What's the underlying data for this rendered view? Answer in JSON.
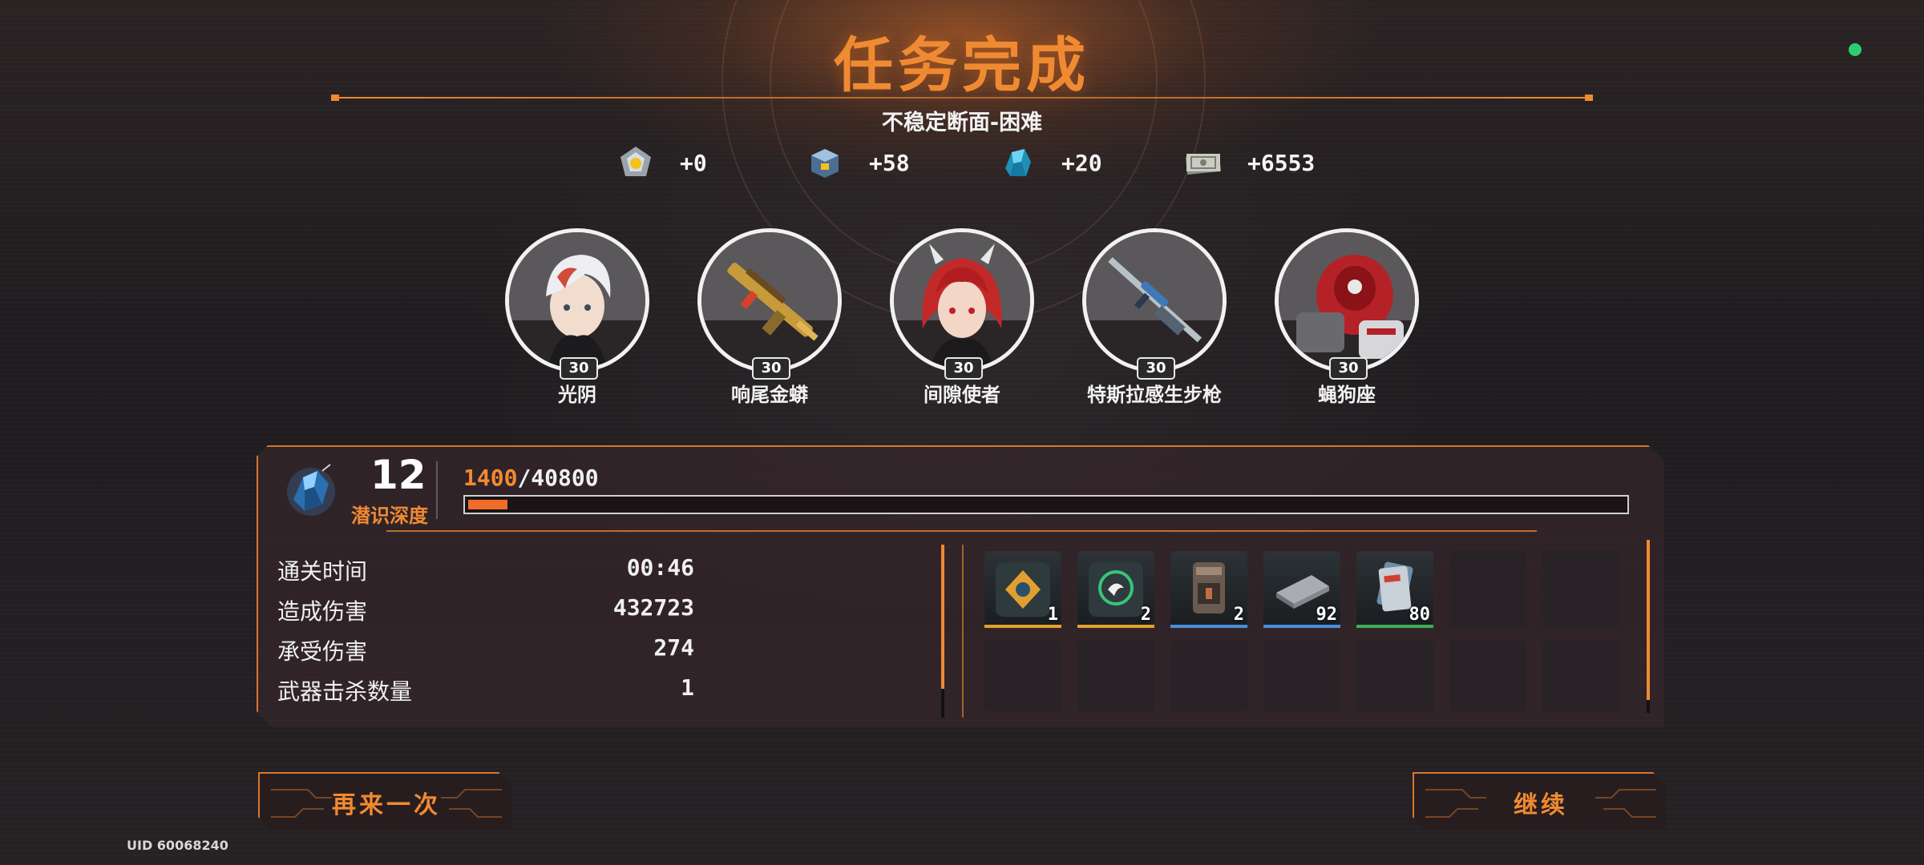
{
  "header": {
    "title": "任务完成",
    "stage": "不稳定断面-困难"
  },
  "rewards": [
    {
      "icon": "gold-shield-crystal-icon",
      "value": "+0"
    },
    {
      "icon": "blue-supply-crate-icon",
      "value": "+58"
    },
    {
      "icon": "blue-ore-crystal-icon",
      "value": "+20"
    },
    {
      "icon": "banknote-stack-icon",
      "value": "+6553"
    }
  ],
  "team": [
    {
      "name": "光阴",
      "level": "30",
      "icon": "white-haired-character-portrait"
    },
    {
      "name": "响尾金蟒",
      "level": "30",
      "icon": "golden-rifle-portrait"
    },
    {
      "name": "间隙使者",
      "level": "30",
      "icon": "red-haired-character-portrait"
    },
    {
      "name": "特斯拉感生步枪",
      "level": "30",
      "icon": "blue-sniper-rifle-portrait"
    },
    {
      "name": "蝇狗座",
      "level": "30",
      "icon": "red-mech-portrait"
    }
  ],
  "depth": {
    "level": "12",
    "label": "潜识深度",
    "xp_current": "1400",
    "xp_sep": "/",
    "xp_max": "40800",
    "progress": 0.034
  },
  "stats": [
    {
      "label": "通关时间",
      "value": "00:46"
    },
    {
      "label": "造成伤害",
      "value": "432723"
    },
    {
      "label": "承受伤害",
      "value": "274"
    },
    {
      "label": "武器击杀数量",
      "value": "1"
    }
  ],
  "loot": [
    {
      "count": "1",
      "quality": "gold",
      "quality_color": "#e0a030",
      "icon": "gold-emblem-chip-icon"
    },
    {
      "count": "2",
      "quality": "gold",
      "quality_color": "#e0a030",
      "icon": "green-bird-badge-icon"
    },
    {
      "count": "2",
      "quality": "blue",
      "quality_color": "#4a8fd8",
      "icon": "ammo-canister-icon"
    },
    {
      "count": "92",
      "quality": "blue",
      "quality_color": "#4a8fd8",
      "icon": "metal-plate-icon"
    },
    {
      "count": "80",
      "quality": "green",
      "quality_color": "#3fae5a",
      "icon": "blueprint-card-icon"
    }
  ],
  "buttons": {
    "retry": "再来一次",
    "continue": "继续"
  },
  "footer": {
    "uid": "UID 60068240"
  },
  "colors": {
    "accent": "#f08a32",
    "status_dot": "#2ecc71"
  }
}
